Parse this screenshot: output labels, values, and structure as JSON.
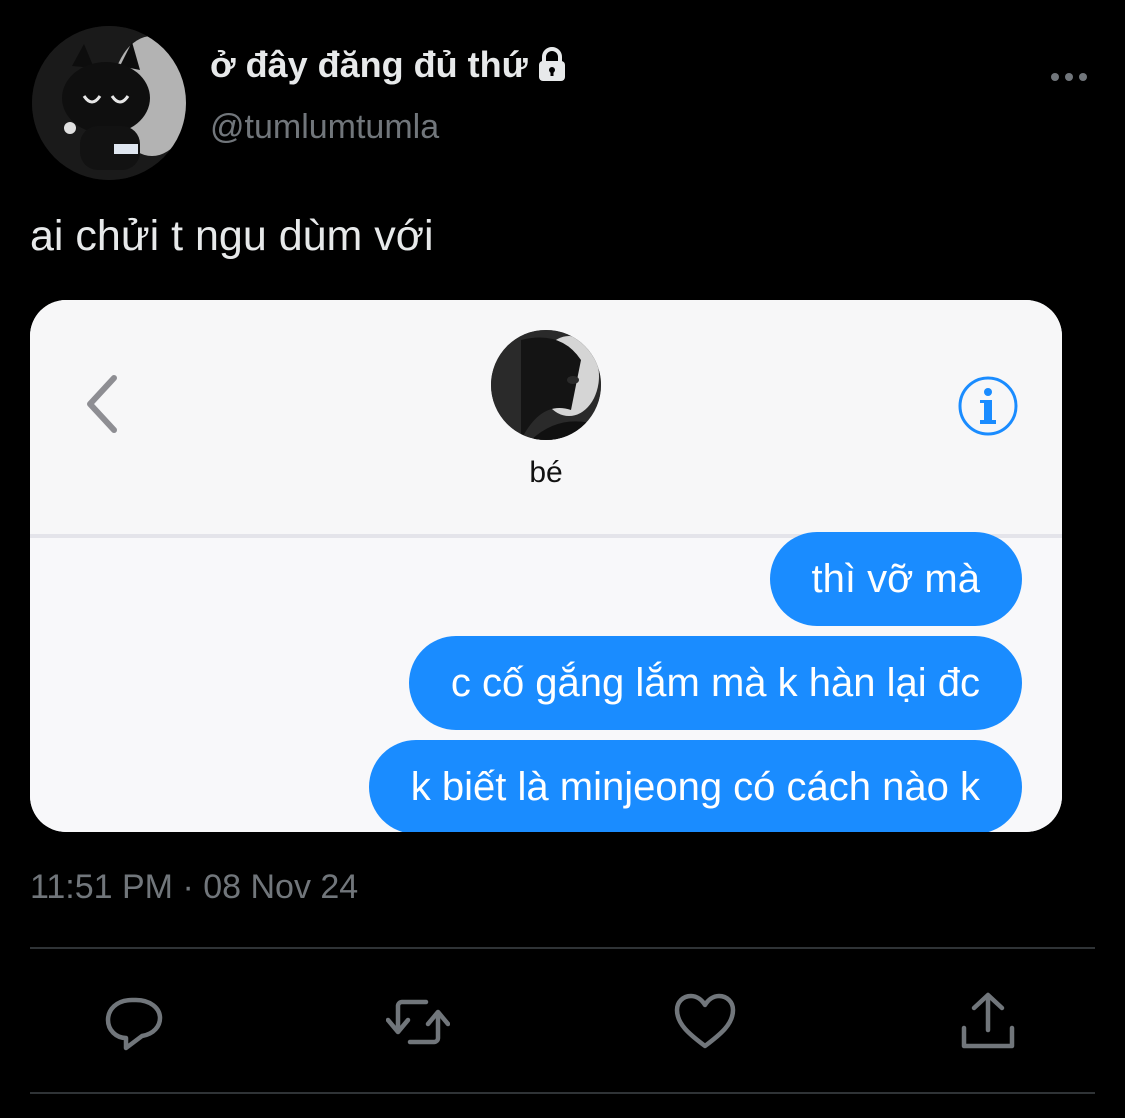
{
  "author": {
    "display_name": "ở đây đăng đủ thứ",
    "handle": "@tumlumtumla",
    "protected_icon": "lock-icon"
  },
  "tweet": {
    "text": "ai chửi t ngu dùm với",
    "timestamp": "11:51 PM · 08 Nov 24"
  },
  "media": {
    "contact_name": "bé",
    "messages": [
      "thì vỡ mà",
      "c cố gắng lắm mà k hàn lại đc",
      "k biết là minjeong có cách nào k"
    ],
    "bubble_color": "#1a8cff",
    "accent_color": "#1a8cff"
  },
  "actions": {
    "reply_icon": "reply-icon",
    "retweet_icon": "retweet-icon",
    "like_icon": "heart-icon",
    "share_icon": "share-icon"
  },
  "colors": {
    "background": "#000000",
    "primary_text": "#e7e9ea",
    "secondary_text": "#71767b",
    "divider": "#2f3336"
  }
}
